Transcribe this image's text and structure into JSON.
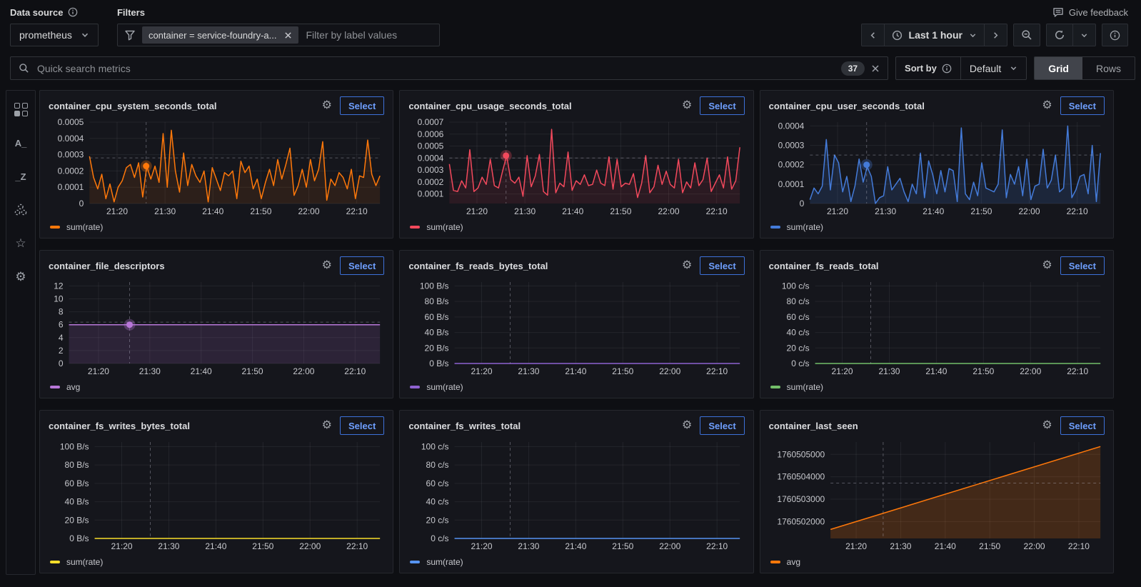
{
  "header": {
    "data_source_label": "Data source",
    "filters_label": "Filters",
    "datasource_value": "prometheus",
    "filter_chip": "container = service-foundry-a...",
    "filter_placeholder": "Filter by label values",
    "give_feedback": "Give feedback",
    "time_range": "Last 1 hour"
  },
  "searchbar": {
    "placeholder": "Quick search metrics",
    "count_badge": "37",
    "sort_by_label": "Sort by",
    "sort_value": "Default",
    "view_grid": "Grid",
    "view_rows": "Rows"
  },
  "sidebar": {
    "star_glyph": "☆",
    "gear_glyph": "⚙",
    "sort_az_glyph": "A_",
    "sort_za_glyph": "_Z"
  },
  "labels": {
    "select": "Select"
  },
  "xticks": [
    "21:20",
    "21:30",
    "21:40",
    "21:50",
    "22:00",
    "22:10"
  ],
  "crosshair_frac": 0.195,
  "chart_data": [
    {
      "type": "line",
      "title": "container_cpu_system_seconds_total",
      "legend": "sum(rate)",
      "color": "#FF780A",
      "fill_opacity": 0.1,
      "ymin": 0,
      "ymax": 0.0005,
      "marker": 0.00023,
      "hline": 0.00028,
      "yticks": [
        {
          "label": "0",
          "value": 0
        },
        {
          "label": "0.0001",
          "value": 0.0001
        },
        {
          "label": "0.0002",
          "value": 0.0002
        },
        {
          "label": "0.0003",
          "value": 0.0003
        },
        {
          "label": "0.0004",
          "value": 0.0004
        },
        {
          "label": "0.0005",
          "value": 0.0005
        }
      ],
      "values": [
        0.00029,
        0.00016,
        9e-05,
        0.00018,
        3e-05,
        0.00012,
        1e-05,
        0.0001,
        0.00014,
        0.00022,
        0.00024,
        0.00016,
        0.00025,
        4e-05,
        0.00023,
        0.00015,
        0.00023,
        0.00013,
        0.00043,
        0.0001,
        0.00045,
        0.0002,
        7e-05,
        0.00031,
        0.00011,
        0.00024,
        0.00017,
        0.00013,
        0.0002,
        1e-05,
        0.00022,
        0.00015,
        8e-05,
        0.00019,
        0.00017,
        0.0002,
        3e-05,
        0.00026,
        0.00019,
        0.00023,
        9e-05,
        0.00015,
        3e-05,
        0.00013,
        0.00021,
        0.00011,
        0.00027,
        0.00015,
        0.00024,
        0.00034,
        5e-05,
        0.00011,
        0.00021,
        0.0001,
        0.00027,
        0.00014,
        0.00021,
        0.00038,
        2e-05,
        0.00015,
        0.00011,
        0.00019,
        0.00016,
        9e-05,
        0.00021,
        3e-05,
        0.00017,
        0.00016,
        0.00039,
        0.00018,
        0.00011,
        0.00017
      ]
    },
    {
      "type": "line",
      "title": "container_cpu_usage_seconds_total",
      "legend": "sum(rate)",
      "color": "#F2495C",
      "fill_opacity": 0.1,
      "ymin": 2e-05,
      "ymax": 0.0007,
      "marker": 0.00042,
      "hline": 0.0004,
      "yticks": [
        {
          "label": "0.0001",
          "value": 0.0001
        },
        {
          "label": "0.0002",
          "value": 0.0002
        },
        {
          "label": "0.0003",
          "value": 0.0003
        },
        {
          "label": "0.0004",
          "value": 0.0004
        },
        {
          "label": "0.0005",
          "value": 0.0005
        },
        {
          "label": "0.0006",
          "value": 0.0006
        },
        {
          "label": "0.0007",
          "value": 0.0007
        }
      ],
      "values": [
        0.00035,
        0.00013,
        0.00012,
        0.00021,
        0.00015,
        0.00047,
        0.00012,
        0.00015,
        0.00024,
        0.00018,
        0.00039,
        0.00017,
        0.00015,
        0.00029,
        0.00042,
        0.00022,
        0.00019,
        0.00024,
        8e-05,
        0.00042,
        0.00016,
        0.00025,
        0.00043,
        0.00012,
        9e-05,
        0.00064,
        0.00011,
        0.00019,
        0.00016,
        0.00045,
        0.00013,
        0.00021,
        0.00018,
        0.00026,
        0.00017,
        0.00018,
        0.0003,
        0.00019,
        0.00017,
        0.00041,
        0.00014,
        0.00039,
        0.00016,
        0.00019,
        0.00018,
        0.00027,
        7e-05,
        0.00019,
        0.00042,
        0.00011,
        0.00016,
        0.00034,
        0.00018,
        0.00029,
        0.00018,
        0.00015,
        0.00039,
        0.00011,
        0.0002,
        0.00015,
        0.00036,
        0.00017,
        0.00022,
        0.0004,
        0.00012,
        0.00019,
        0.00026,
        0.00015,
        0.00041,
        0.00014,
        0.00021,
        0.00049
      ]
    },
    {
      "type": "line",
      "title": "container_cpu_user_seconds_total",
      "legend": "sum(rate)",
      "color": "#447BD9",
      "fill_opacity": 0.16,
      "ymin": 0,
      "ymax": 0.00042,
      "marker": 0.0002,
      "hline": 0.00025,
      "yticks": [
        {
          "label": "0",
          "value": 0
        },
        {
          "label": "0.0001",
          "value": 0.0001
        },
        {
          "label": "0.0002",
          "value": 0.0002
        },
        {
          "label": "0.0003",
          "value": 0.0003
        },
        {
          "label": "0.0004",
          "value": 0.0004
        }
      ],
      "values": [
        2e-05,
        8e-05,
        5e-05,
        9e-05,
        0.00033,
        7e-05,
        0.00025,
        0.00021,
        6e-05,
        0.00014,
        1e-05,
        9e-05,
        0.00023,
        0.00011,
        0.00019,
        0.00014,
        0,
        3e-05,
        4e-05,
        0.00019,
        7e-05,
        0.0001,
        0.00013,
        6e-05,
        1e-05,
        0.0001,
        5e-05,
        0.00026,
        3e-05,
        0.00022,
        0.00015,
        5e-05,
        0.00017,
        6e-05,
        0.00018,
        0.00017,
        1e-05,
        0.00039,
        5e-05,
        2e-05,
        0.00011,
        4e-05,
        0.00021,
        8e-05,
        7e-05,
        6e-05,
        0.0001,
        0.00038,
        3e-05,
        0.00015,
        0.0001,
        0.00019,
        4e-05,
        0.00023,
        2e-05,
        9e-05,
        0.0001,
        0.00028,
        8e-05,
        0.00012,
        0.00025,
        6e-05,
        8e-05,
        0.0004,
        3e-05,
        7e-05,
        0.00014,
        0.00015,
        5e-05,
        0.0003,
        1e-05,
        0.00026
      ]
    },
    {
      "type": "line",
      "title": "container_file_descriptors",
      "legend": "avg",
      "color": "#B877D9",
      "fill_opacity": 0.14,
      "ymin": 0,
      "ymax": 12.6,
      "marker": 6,
      "hline": 6.4,
      "yticks": [
        {
          "label": "0",
          "value": 0
        },
        {
          "label": "2",
          "value": 2
        },
        {
          "label": "4",
          "value": 4
        },
        {
          "label": "6",
          "value": 6
        },
        {
          "label": "8",
          "value": 8
        },
        {
          "label": "10",
          "value": 10
        },
        {
          "label": "12",
          "value": 12
        }
      ],
      "values": [
        6,
        6
      ]
    },
    {
      "type": "line",
      "title": "container_fs_reads_bytes_total",
      "legend": "sum(rate)",
      "color": "#8F62D1",
      "fill_opacity": 0,
      "ymin": 0,
      "ymax": 105,
      "marker": null,
      "hline": null,
      "yticks": [
        {
          "label": "0 B/s",
          "value": 0
        },
        {
          "label": "20 B/s",
          "value": 20
        },
        {
          "label": "40 B/s",
          "value": 40
        },
        {
          "label": "60 B/s",
          "value": 60
        },
        {
          "label": "80 B/s",
          "value": 80
        },
        {
          "label": "100 B/s",
          "value": 100
        }
      ],
      "values": [
        0,
        0
      ]
    },
    {
      "type": "line",
      "title": "container_fs_reads_total",
      "legend": "sum(rate)",
      "color": "#73BF69",
      "fill_opacity": 0,
      "ymin": 0,
      "ymax": 105,
      "marker": null,
      "hline": null,
      "yticks": [
        {
          "label": "0 c/s",
          "value": 0
        },
        {
          "label": "20 c/s",
          "value": 20
        },
        {
          "label": "40 c/s",
          "value": 40
        },
        {
          "label": "60 c/s",
          "value": 60
        },
        {
          "label": "80 c/s",
          "value": 80
        },
        {
          "label": "100 c/s",
          "value": 100
        }
      ],
      "values": [
        0,
        0
      ]
    },
    {
      "type": "line",
      "title": "container_fs_writes_bytes_total",
      "legend": "sum(rate)",
      "color": "#FADE2A",
      "fill_opacity": 0,
      "ymin": 0,
      "ymax": 105,
      "marker": null,
      "hline": null,
      "yticks": [
        {
          "label": "0 B/s",
          "value": 0
        },
        {
          "label": "20 B/s",
          "value": 20
        },
        {
          "label": "40 B/s",
          "value": 40
        },
        {
          "label": "60 B/s",
          "value": 60
        },
        {
          "label": "80 B/s",
          "value": 80
        },
        {
          "label": "100 B/s",
          "value": 100
        }
      ],
      "values": [
        0,
        0
      ]
    },
    {
      "type": "line",
      "title": "container_fs_writes_total",
      "legend": "sum(rate)",
      "color": "#5794F2",
      "fill_opacity": 0,
      "ymin": 0,
      "ymax": 105,
      "marker": null,
      "hline": null,
      "yticks": [
        {
          "label": "0 c/s",
          "value": 0
        },
        {
          "label": "20 c/s",
          "value": 20
        },
        {
          "label": "40 c/s",
          "value": 40
        },
        {
          "label": "60 c/s",
          "value": 60
        },
        {
          "label": "80 c/s",
          "value": 80
        },
        {
          "label": "100 c/s",
          "value": 100
        }
      ],
      "values": [
        0,
        0
      ]
    },
    {
      "type": "line",
      "title": "container_last_seen",
      "legend": "avg",
      "color": "#FF780A",
      "fill_opacity": 0.2,
      "ymin": 1760501250,
      "ymax": 1760505550,
      "marker": null,
      "hline": 1760503720,
      "yticks": [
        {
          "label": "1760502000",
          "value": 1760502000
        },
        {
          "label": "1760503000",
          "value": 1760503000
        },
        {
          "label": "1760504000",
          "value": 1760504000
        },
        {
          "label": "1760505000",
          "value": 1760505000
        }
      ],
      "values": [
        1760501650,
        1760505350
      ]
    }
  ],
  "colors": {
    "accent_blue_border": "#3d71d9",
    "accent_blue_text": "#6e9fff",
    "axis_text": "#c7c8cd",
    "grid_line": "rgba(204,204,220,0.08)",
    "crosshair": "rgba(204,204,220,0.35)"
  }
}
